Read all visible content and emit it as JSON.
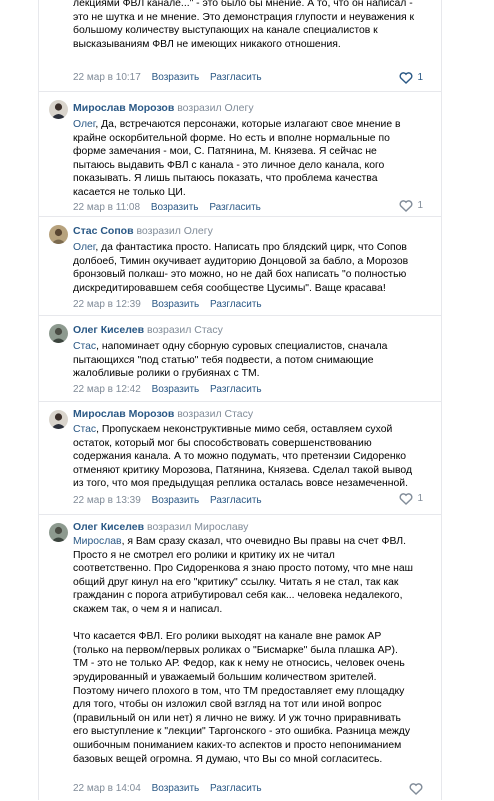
{
  "ui": {
    "reply_label": "Возразить",
    "unlike_label": "Разгласить"
  },
  "comments": [
    {
      "lines": [
        "лекциями ФВЛ канале...\" - это было бы мнение. А то, что он написал -",
        "это не шутка и не мнение. Это демонстрация глупости и неуважения к",
        "большому количеству выступающих на канале специалистов к",
        "высказываниям ФВЛ не имеющих никакого отношения."
      ],
      "date": "22 мар в 10:17",
      "likes": "1",
      "liked": true
    },
    {
      "author": "Мирослав Морозов",
      "reply_to": "возразил Олегу",
      "addressee": "Олег",
      "lines": [
        ", Да, встречаются персонажи, которые излагают свое мнение в",
        "крайне оскорбительной форме. Но есть и вполне нормальные по",
        "форме замечания - мои, С. Патянина, М. Князева. Я сейчас не",
        "пытаюсь выдавить ФВЛ с канала - это личное дело канала, кого",
        "показывать. Я лишь пытаюсь показать, что проблема качества",
        "касается не только ЦИ."
      ],
      "date": "22 мар в 11:08",
      "likes": "1",
      "liked": false
    },
    {
      "author": "Стас Сопов",
      "reply_to": "возразил Олегу",
      "addressee": "Олег",
      "lines": [
        ", да фантастика просто. Написать про блядский цирк, что Сопов",
        "долбоеб, Тимин окучивает аудиторию Донцовой за бабло, а Морозов",
        "бронзовый полкаш- это можно, но не дай бох написать \"о полностью",
        "дискредитировавшем себя сообществе Цусимы\". Ваще красава!"
      ],
      "date": "22 мар в 12:39",
      "likes": "",
      "liked": false
    },
    {
      "author": "Олег Киселев",
      "reply_to": "возразил Стасу",
      "addressee": "Стас",
      "lines": [
        ", напоминает одну сборную суровых специалистов, сначала",
        "пытающихся \"под статью\" тебя подвести, а потом снимающие",
        "жалобливые ролики о грубиянах с ТМ."
      ],
      "date": "22 мар в 12:42",
      "likes": "",
      "liked": false
    },
    {
      "author": "Мирослав Морозов",
      "reply_to": "возразил Стасу",
      "addressee": "Стас",
      "lines": [
        ", Пропускаем неконструктивные мимо себя, оставляем сухой",
        "остаток, который мог бы способствовать совершенствованию",
        "содержания канала. А то можно подумать, что претензии Сидоренко",
        "отменяют критику Морозова, Патянина, Князева. Сделал такой вывод",
        "из того, что моя предыдущая реплика осталась вовсе незамеченной."
      ],
      "date": "22 мар в 13:39",
      "likes": "1",
      "liked": false
    },
    {
      "author": "Олег Киселев",
      "reply_to": "возразил Мирославу",
      "addressee": "Мирослав",
      "lines": [
        ", я Вам сразу сказал, что очевидно Вы правы на счет ФВЛ.",
        "Просто я не смотрел его ролики и критику их не читал",
        "соответственно. Про Сидоренкова я знаю просто потому, что мне наш",
        "общий друг кинул на его \"критику\" ссылку. Читать я не стал, так как",
        "гражданин с порога атрибутировал себя как... человека недалекого,",
        "скажем так, о чем я и написал.",
        "",
        "Что касается ФВЛ. Его ролики выходят на канале вне рамок АР",
        "(только на первом/первых роликах о \"Бисмарке\" была плашка АР).",
        "ТМ - это не только АР. Федор, как к нему не относись, человек очень",
        "эрудированный и уважаемый большим количеством зрителей.",
        "Поэтому ничего плохого в том, что ТМ предоставляет ему площадку",
        "для того, чтобы он изложил свой взгляд на тот или иной вопрос",
        "(правильный он или нет) я лично не вижу. И уж точно приравнивать",
        "его выступление к \"лекции\" Таргонского - это ошибка. Разница между",
        "ошибочным пониманием каких-то аспектов и просто непониманием",
        "базовых вещей огромна. Я думаю, что Вы со мной согласитесь."
      ],
      "date": "22 мар в 14:04",
      "likes": "",
      "liked": false
    }
  ]
}
